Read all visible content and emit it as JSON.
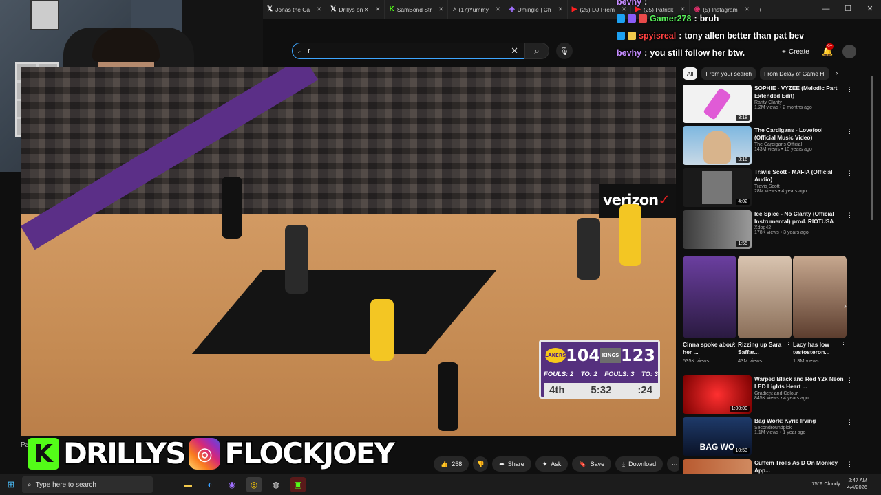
{
  "browser": {
    "tabs": [
      {
        "label": "Jonas the Ca",
        "icon": "x-logo-icon",
        "glyph": "𝕏",
        "color": "#ffffff"
      },
      {
        "label": "Drillys on X",
        "icon": "x-logo-icon",
        "glyph": "𝕏",
        "color": "#ffffff"
      },
      {
        "label": "SamBond Str",
        "icon": "kick-logo-icon",
        "glyph": "K",
        "color": "#53fc18"
      },
      {
        "label": "(17)Yummy",
        "icon": "tiktok-logo-icon",
        "glyph": "♪",
        "color": "#ffffff"
      },
      {
        "label": "Umingle | Ch",
        "icon": "umingle-logo-icon",
        "glyph": "◈",
        "color": "#a070ff"
      },
      {
        "label": "(25) DJ Prem",
        "icon": "youtube-logo-icon",
        "glyph": "▶",
        "color": "#ff2020"
      },
      {
        "label": "(25) Patrick",
        "icon": "youtube-logo-icon",
        "glyph": "▶",
        "color": "#ff2020"
      },
      {
        "label": "(5) Instagram",
        "icon": "instagram-logo-icon",
        "glyph": "◉",
        "color": "#e1306c"
      }
    ],
    "new_tab": "+",
    "window_controls": {
      "minimize": "—",
      "maximize": "☐",
      "close": "✕"
    }
  },
  "chat": {
    "messages": [
      {
        "user": "bevhy",
        "text": ""
      },
      {
        "user": "Gamer278",
        "text": "bruh"
      },
      {
        "user": "spyisreal",
        "text": "tony allen better than pat bev"
      },
      {
        "user": "bevhy",
        "text": "you still follow her btw."
      }
    ]
  },
  "youtube": {
    "search_value": "r",
    "search_clear": "✕",
    "search_icon": "⌕",
    "mic_icon": "🎙",
    "create_label": "Create",
    "notif_count": "9+",
    "chips": [
      "All",
      "From your search",
      "From Delay of Game Hi"
    ],
    "chip_next": "›",
    "recommendations": [
      {
        "title": "SOPHIE - VYZEE (Melodic Part Extended Edit)",
        "channel": "Rarity Clarity",
        "stats": "1.2M views • 2 months ago",
        "duration": "3:18"
      },
      {
        "title": "The Cardigans - Lovefool (Official Music Video)",
        "channel": "The Cardigans Official",
        "stats": "143M views • 10 years ago",
        "duration": "3:16"
      },
      {
        "title": "Travis Scott - MAFIA (Official Audio)",
        "channel": "Travis Scott",
        "stats": "28M views • 4 years ago",
        "duration": "4:02"
      },
      {
        "title": "Ice Spice - No Clarity (Official Instrumental) prod. RIOTUSA",
        "channel": "Xdog42",
        "stats": "178K views • 3 years ago",
        "duration": "1:55"
      }
    ],
    "shorts": [
      {
        "title": "Cinna spoke about her ...",
        "views": "535K views"
      },
      {
        "title": "Rizzing up Sara Saffar...",
        "views": "43M views"
      },
      {
        "title": "Lacy has low testosteron...",
        "views": "1.3M views"
      }
    ],
    "recommendations2": [
      {
        "title": "Warped Black and Red Y2k Neon LED Lights Heart ...",
        "channel": "Gradient and Colour",
        "stats": "845K views • 4 years ago",
        "duration": "1:00:00"
      },
      {
        "title": "Bag Work: Kyrie Irving",
        "channel": "Secondroundpick",
        "stats": "1.1M views • 1 year ago",
        "duration": "10:53"
      },
      {
        "title": "Cuffem Trolls As D On Monkey App...",
        "channel": "",
        "stats": "",
        "duration": ""
      }
    ],
    "actions": {
      "likes": "258",
      "share": "Share",
      "ask": "Ask",
      "save": "Save",
      "download": "Download",
      "more": "⋯"
    },
    "below_video_left": "Pa"
  },
  "video": {
    "scorebug": {
      "home_score": "104",
      "away_score": "123",
      "home_team": "LAKERS",
      "away_team": "KINGS",
      "home_fouls": "FOULS: 2",
      "home_to": "TO: 2",
      "away_fouls": "FOULS: 3",
      "away_to": "TO: 3",
      "quarter": "4th",
      "clock": "5:32",
      "shot_clock": ":24"
    },
    "signboard": "verizon",
    "signboard_mark": "✓"
  },
  "overlay": {
    "kick_glyph": "K",
    "kick_name": "DRILLYS",
    "ig_glyph": "◎",
    "ig_name": "FLOCKJOEY"
  },
  "taskbar": {
    "start_glyph": "⊞",
    "search_placeholder": "Type here to search",
    "weather": "75°F Cloudy",
    "time": "2:47 AM",
    "date": "4/4/2026"
  }
}
